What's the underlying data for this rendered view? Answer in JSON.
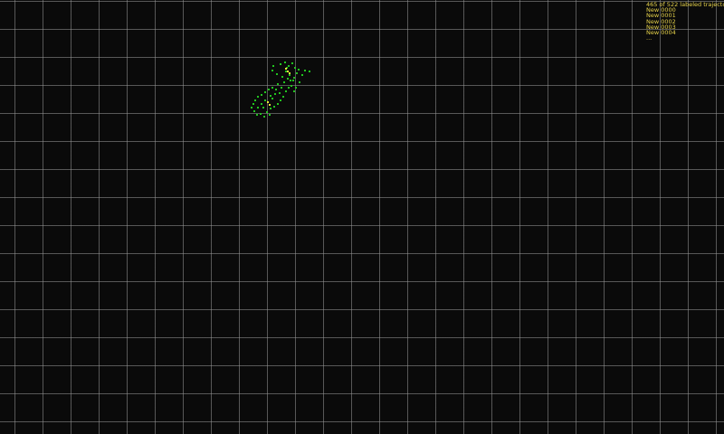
{
  "hud": {
    "summary": "465 of 522 labeled trajectories n",
    "items": [
      "New 0000",
      "New 0001",
      "New 0002",
      "New 0003",
      "New 0004"
    ],
    "more": "..."
  },
  "colors": {
    "background": "#0a0a0a",
    "grid": "#969696",
    "marker_unlabeled": "#22c41f",
    "marker_selected": "#e8e23a",
    "hud_text": "#e6d24a"
  }
}
